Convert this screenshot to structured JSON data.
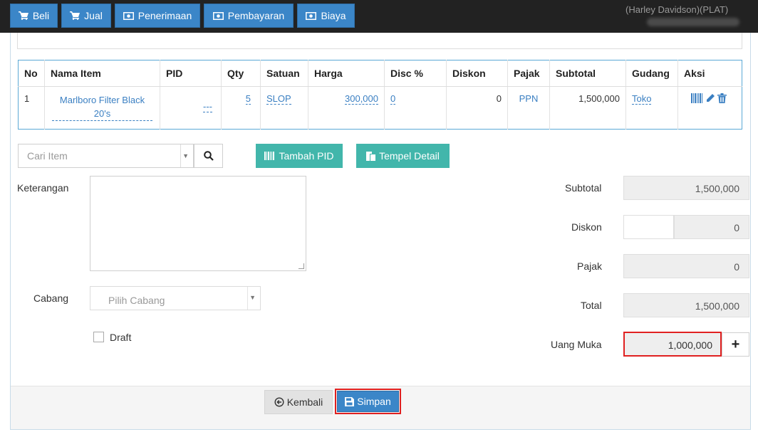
{
  "nav": {
    "buttons": [
      {
        "label": "Beli",
        "icon": "cart-icon"
      },
      {
        "label": "Jual",
        "icon": "cart-icon"
      },
      {
        "label": "Penerimaan",
        "icon": "money-icon"
      },
      {
        "label": "Pembayaran",
        "icon": "money-icon"
      },
      {
        "label": "Biaya",
        "icon": "money-icon"
      }
    ],
    "user_name": "(Harley Davidson)(PLAT)"
  },
  "table": {
    "headers": [
      "No",
      "Nama Item",
      "PID",
      "Qty",
      "Satuan",
      "Harga",
      "Disc %",
      "Diskon",
      "Pajak",
      "Subtotal",
      "Gudang",
      "Aksi"
    ],
    "rows": [
      {
        "no": "1",
        "nama_item": "Marlboro Filter Black 20's",
        "pid": "---",
        "qty": "5",
        "satuan": "SLOP",
        "harga": "300,000",
        "disc_pct": "0",
        "diskon": "0",
        "pajak": "PPN",
        "subtotal": "1,500,000",
        "gudang": "Toko"
      }
    ]
  },
  "search": {
    "placeholder": "Cari Item"
  },
  "actions": {
    "tambah_pid": "Tambah PID",
    "tempel_detail": "Tempel Detail"
  },
  "form": {
    "keterangan_label": "Keterangan",
    "cabang_label": "Cabang",
    "cabang_placeholder": "Pilih Cabang",
    "draft_label": "Draft"
  },
  "totals": {
    "subtotal_label": "Subtotal",
    "subtotal_value": "1,500,000",
    "diskon_label": "Diskon",
    "diskon_value": "0",
    "pajak_label": "Pajak",
    "pajak_value": "0",
    "total_label": "Total",
    "total_value": "1,500,000",
    "uang_muka_label": "Uang Muka",
    "uang_muka_value": "1,000,000",
    "plus_label": "+"
  },
  "footer": {
    "kembali_label": "Kembali",
    "simpan_label": "Simpan"
  },
  "colors": {
    "primary": "#3b86c8",
    "teal": "#42b6ab",
    "highlight": "#e02020",
    "topbar": "#222222"
  }
}
